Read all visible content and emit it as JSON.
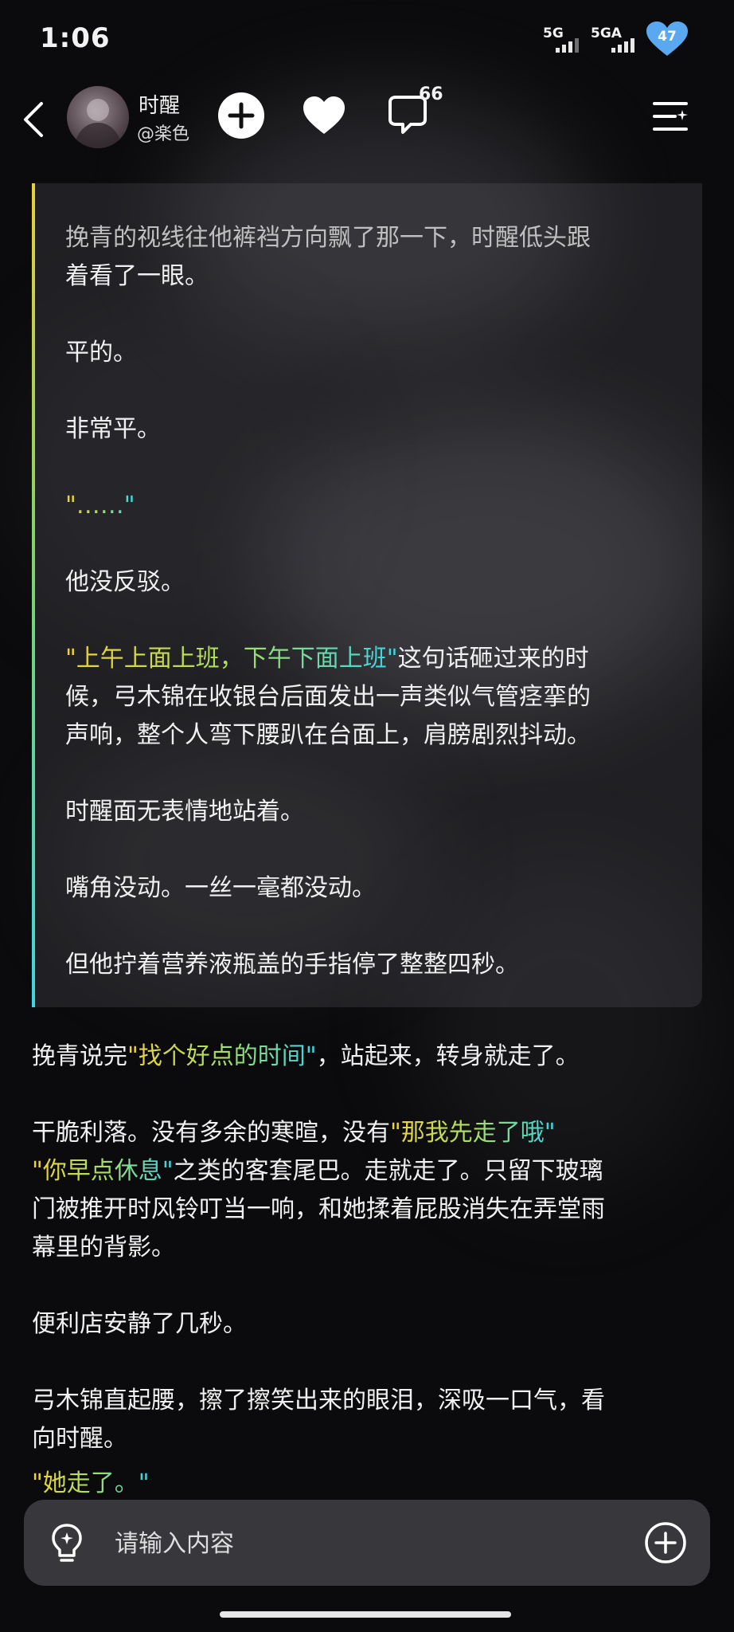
{
  "status_bar": {
    "time": "1:06",
    "signal_1_label": "5G",
    "signal_2_label": "5GA",
    "battery_level": "47"
  },
  "header": {
    "author_name": "时醒",
    "author_handle": "@楽色",
    "comment_count": "66"
  },
  "quote": {
    "lines": [
      "挽青的视线往他裤裆方向飘了那一下，时醒低头跟",
      "着看了一眼。"
    ],
    "p_flat": "平的。",
    "p_very_flat": "非常平。",
    "p_ellipsis": "\"……\"",
    "p_no_refute": "他没反驳。",
    "p_quote_highlight": "\"上午上面上班，下午下面上班\"",
    "p_quote_rest_1": "这句话砸过来的时",
    "p_quote_rest_2": "候，弓木锦在收银台后面发出一声类似气管痉挛的",
    "p_quote_rest_3": "声响，整个人弯下腰趴在台面上，肩膀剧烈抖动。",
    "p_expressionless": "时醒面无表情地站着。",
    "p_mouth": "嘴角没动。一丝一毫都没动。",
    "p_fingers": "但他拧着营养液瓶盖的手指停了整整四秒。"
  },
  "body": {
    "p1_a": "挽青说完",
    "p1_hl": "\"找个好点的时间\"",
    "p1_b": "，站起来，转身就走了。",
    "p2_a": "干脆利落。没有多余的寒暄，没有",
    "p2_hl1": "\"那我先走了哦\"",
    "p2_hl2": "\"你早点休息\"",
    "p2_b": "之类的客套尾巴。走就走了。只留下玻璃",
    "p2_c": "门被推开时风铃叮当一响，和她揉着屁股消失在弄堂雨",
    "p2_d": "幕里的背影。",
    "p3": "便利店安静了几秒。",
    "p4_a": "弓木锦直起腰，擦了擦笑出来的眼泪，深吸一口气，看",
    "p4_b": "向时醒。",
    "p5_hl": "\"她走了。\""
  },
  "input": {
    "placeholder": "请输入内容"
  },
  "icons": {
    "back": "chevron-left-icon",
    "follow": "plus-icon",
    "like": "heart-icon",
    "comment": "comment-icon",
    "menu": "menu-icon",
    "idea": "lightbulb-icon",
    "add": "add-circle-icon",
    "battery": "heart-battery-icon"
  },
  "colors": {
    "background": "#0b0b0d",
    "highlight_start": "#f2d233",
    "highlight_mid": "#a8e060",
    "highlight_end": "#39d3e6",
    "battery": "#5aa8f0"
  }
}
